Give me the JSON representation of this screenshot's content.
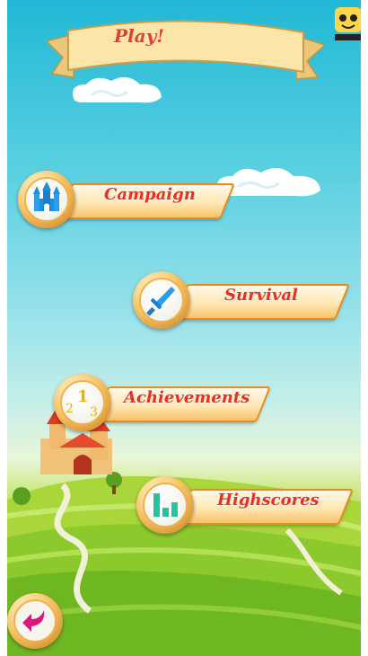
{
  "title": "Play!",
  "menu": [
    {
      "label": "Campaign",
      "icon": "castle-icon"
    },
    {
      "label": "Survival",
      "icon": "sword-icon"
    },
    {
      "label": "Achievements",
      "icon": "podium-numbers-icon"
    },
    {
      "label": "Highscores",
      "icon": "bar-chart-icon"
    }
  ],
  "back": {
    "icon": "back-arrow-icon"
  },
  "colors": {
    "label": "#ea2f22",
    "ribbon_border": "#e88a1c",
    "sky": "#21b8d6",
    "grass": "#7cc126"
  }
}
